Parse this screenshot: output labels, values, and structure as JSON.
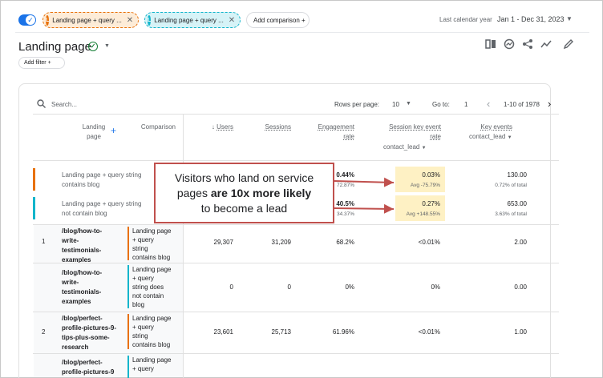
{
  "comparison_bar": {
    "chips": [
      {
        "badge": "L",
        "label": "Landing page + query ..."
      },
      {
        "badge": "L",
        "label": "Landing page + query ..."
      }
    ],
    "add_comparison": "Add comparison +",
    "date_label": "Last calendar year",
    "date_range": "Jan 1 - Dec 31, 2023"
  },
  "header": {
    "title": "Landing page",
    "add_filter": "Add filter +"
  },
  "toolbar": {
    "search_placeholder": "Search...",
    "rows_per_page_label": "Rows per page:",
    "rows_per_page": "10",
    "goto_label": "Go to:",
    "goto_value": "1",
    "pager": "1-10 of 1978"
  },
  "table": {
    "headers": {
      "dim_line1": "Landing",
      "dim_line2": "page",
      "comparison": "Comparison",
      "users": "Users",
      "sessions": "Sessions",
      "eng_line1": "Engagement",
      "eng_line2": "rate",
      "skr_line1": "Session key event",
      "skr_line2": "rate",
      "skr_event": "contact_lead",
      "ke_line1": "Key events",
      "ke_event": "contact_lead"
    },
    "summary": [
      {
        "label_line1": "Landing page + query string",
        "label_line2": "contains blog",
        "eng": "0.44%",
        "eng_sub": "72.87%",
        "skr": "0.03%",
        "skr_sub": "Avg -75.79%",
        "ke": "130.00",
        "ke_sub": "0.72% of total"
      },
      {
        "label_line1": "Landing page + query string",
        "label_line2": "not contain blog",
        "eng": "40.5%",
        "eng_sub": "34.37%",
        "skr": "0.27%",
        "skr_sub": "Avg +148.55%",
        "ke": "653.00",
        "ke_sub": "3.63% of total"
      }
    ],
    "rows": [
      {
        "num": "1",
        "dim": [
          "/blog/how-to-",
          "write-",
          "testimonials-",
          "examples"
        ],
        "cmp": [
          "Landing page",
          "+ query",
          "string",
          "contains blog"
        ],
        "users": "29,307",
        "sessions": "31,209",
        "eng": "68.2%",
        "skr": "<0.01%",
        "ke": "2.00"
      },
      {
        "num": "",
        "dim": [
          "/blog/how-to-",
          "write-",
          "testimonials-",
          "examples"
        ],
        "cmp": [
          "Landing page",
          "+ query",
          "string does",
          "not contain",
          "blog"
        ],
        "users": "0",
        "sessions": "0",
        "eng": "0%",
        "skr": "0%",
        "ke": "0.00"
      },
      {
        "num": "2",
        "dim": [
          "/blog/perfect-",
          "profile-pictures-9-",
          "tips-plus-some-",
          "research"
        ],
        "cmp": [
          "Landing page",
          "+ query",
          "string",
          "contains blog"
        ],
        "users": "23,601",
        "sessions": "25,713",
        "eng": "61.96%",
        "skr": "<0.01%",
        "ke": "1.00"
      },
      {
        "num": "",
        "dim": [
          "/blog/perfect-",
          "profile-pictures-9"
        ],
        "cmp": [
          "Landing page",
          "+ query"
        ],
        "users": "",
        "sessions": "",
        "eng": "",
        "skr": "",
        "ke": ""
      }
    ]
  },
  "callout": {
    "line1": "Visitors who land on service",
    "line2_prefix": "pages ",
    "line2_bold": "are 10x more likely",
    "line3": "to become a lead"
  },
  "colors": {
    "chip1": "#e8710a",
    "chip2": "#12b5cb",
    "accent": "#1a73e8",
    "callout_border": "#c0504d",
    "highlight": "#fef1c4"
  },
  "icons": [
    "compare-icon",
    "insights-icon",
    "share-icon",
    "trend-icon",
    "edit-icon"
  ]
}
